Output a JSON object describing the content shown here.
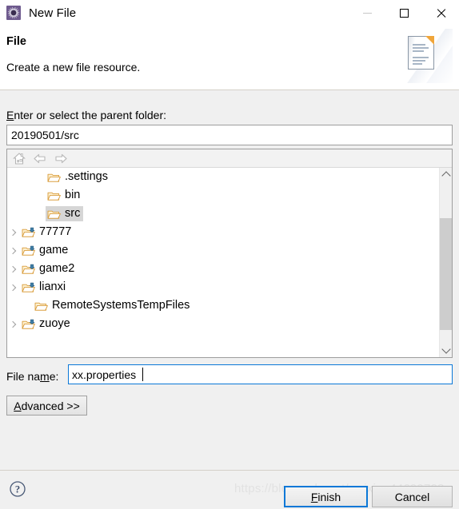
{
  "window": {
    "title": "New File",
    "icon": "eclipse-wizard-icon",
    "controls": {
      "minimize": "minimize-button",
      "maximize": "maximize-button",
      "close": "close-button"
    }
  },
  "header": {
    "title": "File",
    "description": "Create a new file resource.",
    "image": "new-file-document-icon"
  },
  "parent_folder": {
    "label_pre": "",
    "label_mnemonic": "E",
    "label_post": "nter or select the parent folder:",
    "value": "20190501/src",
    "placeholder": ""
  },
  "tree_toolbar": {
    "home": "home-icon",
    "back": "back-arrow-icon",
    "forward": "forward-arrow-icon"
  },
  "tree": {
    "items": [
      {
        "label": ".settings",
        "indent": 2,
        "expandable": false,
        "icon": "folder-icon",
        "selected": false
      },
      {
        "label": "bin",
        "indent": 2,
        "expandable": false,
        "icon": "folder-icon",
        "selected": false
      },
      {
        "label": "src",
        "indent": 2,
        "expandable": false,
        "icon": "folder-icon",
        "selected": true
      },
      {
        "label": "77777",
        "indent": 0,
        "expandable": true,
        "icon": "project-folder-icon",
        "selected": false
      },
      {
        "label": "game",
        "indent": 0,
        "expandable": true,
        "icon": "project-folder-icon",
        "selected": false
      },
      {
        "label": "game2",
        "indent": 0,
        "expandable": true,
        "icon": "project-folder-icon",
        "selected": false
      },
      {
        "label": "lianxi",
        "indent": 0,
        "expandable": true,
        "icon": "project-folder-icon",
        "selected": false
      },
      {
        "label": "RemoteSystemsTempFiles",
        "indent": 1,
        "expandable": false,
        "icon": "folder-icon",
        "selected": false
      },
      {
        "label": "zuoye",
        "indent": 0,
        "expandable": true,
        "icon": "project-folder-icon",
        "selected": false
      }
    ],
    "scrollbar": {
      "up_arrow": "scroll-up-icon",
      "down_arrow": "scroll-down-icon"
    }
  },
  "file_name": {
    "label_pre": "File na",
    "label_mnemonic": "m",
    "label_post": "e:",
    "value": "xx.properties",
    "placeholder": ""
  },
  "buttons": {
    "advanced_pre": "",
    "advanced_mnemonic": "A",
    "advanced_post": "dvanced >>",
    "finish_pre": "",
    "finish_mnemonic": "F",
    "finish_post": "inish",
    "cancel": "Cancel"
  },
  "footer": {
    "help": "help-icon",
    "watermark": "https://blog.csdn.net/weixin_44699728"
  },
  "colors": {
    "accent": "#0a78d7",
    "dialog_bg": "#f0f0f0",
    "field_bg": "#ffffff",
    "selection": "#d6d6d6",
    "folder": "#f5b951",
    "title_icon": "#6e5a8e"
  }
}
